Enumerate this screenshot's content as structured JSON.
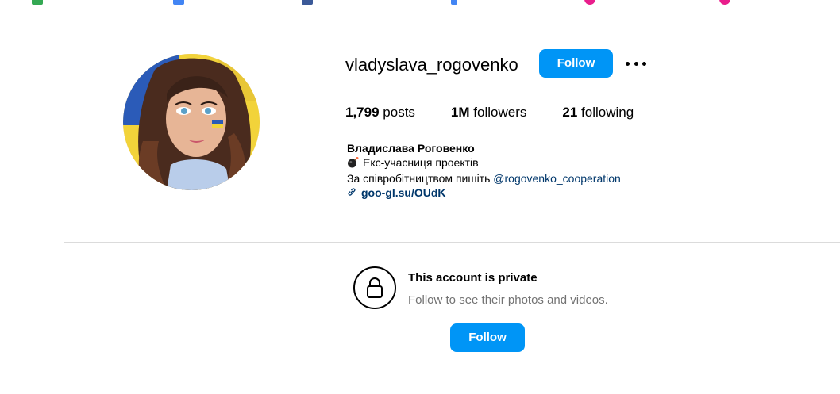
{
  "profile": {
    "username": "vladyslava_rogovenko",
    "follow_label": "Follow",
    "more_icon": "more-options-icon",
    "stats": {
      "posts_count": "1,799",
      "posts_label": "posts",
      "followers_count": "1M",
      "followers_label": "followers",
      "following_count": "21",
      "following_label": "following"
    },
    "bio": {
      "full_name": "Владислава Роговенко",
      "line1": "Екс-учасниця проектів",
      "line2_prefix": "За співробітництвом пишіть",
      "mention": "@rogovenko_cooperation",
      "link": "goo-gl.su/OUdK"
    }
  },
  "private_notice": {
    "title": "This account is private",
    "subtitle": "Follow to see their photos and videos.",
    "follow_label": "Follow"
  },
  "colors": {
    "accent": "#0095f6",
    "link": "#00376b",
    "muted": "#737373",
    "divider": "#dbdbdb"
  }
}
